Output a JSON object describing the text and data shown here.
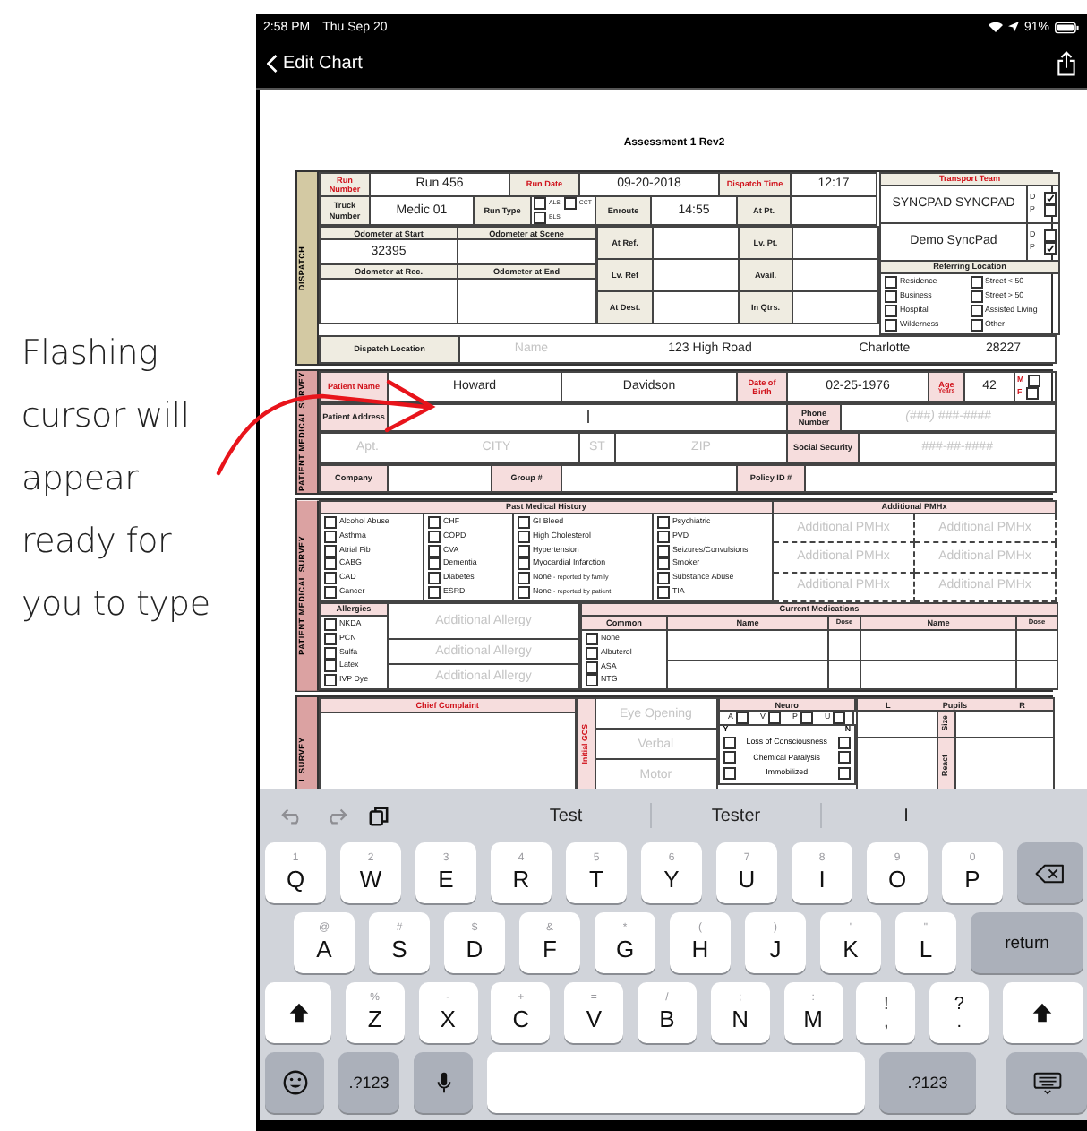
{
  "status_bar": {
    "time": "2:58 PM",
    "date": "Thu Sep 20",
    "battery": "91%"
  },
  "nav": {
    "back_label": "Edit Chart"
  },
  "annotation": {
    "text": "Flashing cursor will appear ready for you to type"
  },
  "form": {
    "title": "Assessment 1 Rev2",
    "dispatch": {
      "side_label": "DISPATCH",
      "run_number": {
        "label": "Run Number",
        "value": "Run 456"
      },
      "run_date": {
        "label": "Run Date",
        "value": "09-20-2018"
      },
      "dispatch_time": {
        "label": "Dispatch Time",
        "value": "12:17"
      },
      "truck_number": {
        "label": "Truck Number",
        "value": "Medic 01"
      },
      "run_type": {
        "label": "Run Type",
        "options": [
          {
            "label": "ALS",
            "checked": false
          },
          {
            "label": "CCT",
            "checked": false
          },
          {
            "label": "BLS",
            "checked": false
          }
        ]
      },
      "times": [
        {
          "label": "Enroute",
          "value": "14:55"
        },
        {
          "label": "At Pt."
        },
        {
          "label": "At Ref."
        },
        {
          "label": "Lv. Pt."
        },
        {
          "label": "Lv. Ref"
        },
        {
          "label": "Avail."
        },
        {
          "label": "At Dest."
        },
        {
          "label": "In Qtrs."
        }
      ],
      "odometers": [
        {
          "label": "Odometer at Start",
          "value": "32395"
        },
        {
          "label": "Odometer at Scene"
        },
        {
          "label": "Odometer at Rec."
        },
        {
          "label": "Odometer at End"
        }
      ],
      "transport_team": {
        "title": "Transport Team",
        "members": [
          {
            "name": "SYNCPAD SYNCPAD",
            "options": [
              {
                "label": "D",
                "checked": true
              },
              {
                "label": "P",
                "checked": false
              }
            ]
          },
          {
            "name": "Demo SyncPad",
            "options": [
              {
                "label": "D",
                "checked": false
              },
              {
                "label": "P",
                "checked": true
              }
            ]
          }
        ]
      },
      "referring_location": {
        "title": "Referring Location",
        "options": [
          {
            "label": "Residence",
            "checked": false
          },
          {
            "label": "Street < 50",
            "checked": false
          },
          {
            "label": "Business",
            "checked": false
          },
          {
            "label": "Street > 50",
            "checked": false
          },
          {
            "label": "Hospital",
            "checked": false
          },
          {
            "label": "Assisted Living",
            "checked": false
          },
          {
            "label": "Wilderness",
            "checked": false
          },
          {
            "label": "Other",
            "checked": false
          }
        ]
      },
      "dispatch_location": {
        "label": "Dispatch Location",
        "name_placeholder": "Name",
        "address": "123 High Road",
        "city": "Charlotte",
        "zip": "28227"
      }
    },
    "patient": {
      "side_labels": [
        "PATIENT MEDICAL SURVEY",
        "PATIENT MEDICAL SURVEY",
        "L SURVEY"
      ],
      "name": {
        "label": "Patient Name",
        "first": "Howard",
        "last": "Davidson"
      },
      "dob": {
        "label": "Date of Birth",
        "value": "02-25-1976"
      },
      "age": {
        "label": "Age",
        "unit": "Years",
        "value": "42"
      },
      "sex": [
        {
          "label": "M",
          "checked": false
        },
        {
          "label": "F",
          "checked": false
        }
      ],
      "address": {
        "label": "Patient Address",
        "focused": true
      },
      "phone": {
        "label": "Phone Number",
        "placeholder": "(###) ###-####"
      },
      "apt": {
        "placeholder": "Apt."
      },
      "city": {
        "placeholder": "CITY"
      },
      "state": {
        "placeholder": "ST"
      },
      "zip": {
        "placeholder": "ZIP"
      },
      "ssn": {
        "label": "Social Security",
        "placeholder": "###-##-####"
      },
      "company": {
        "label": "Company"
      },
      "group": {
        "label": "Group #"
      },
      "policy": {
        "label": "Policy ID #"
      },
      "history": {
        "title": "Past Medical History",
        "columns": [
          [
            {
              "label": "Alcohol Abuse",
              "checked": false
            },
            {
              "label": "Asthma",
              "checked": false
            },
            {
              "label": "Atrial Fib",
              "checked": false
            },
            {
              "label": "CABG",
              "checked": false
            },
            {
              "label": "CAD",
              "checked": false
            },
            {
              "label": "Cancer",
              "checked": false
            }
          ],
          [
            {
              "label": "CHF",
              "checked": false
            },
            {
              "label": "COPD",
              "checked": false
            },
            {
              "label": "CVA",
              "checked": false
            },
            {
              "label": "Dementia",
              "checked": false
            },
            {
              "label": "Diabetes",
              "checked": false
            },
            {
              "label": "ESRD",
              "checked": false
            }
          ],
          [
            {
              "label": "GI Bleed",
              "checked": false
            },
            {
              "label": "High Cholesterol",
              "checked": false
            },
            {
              "label": "Hypertension",
              "checked": false
            },
            {
              "label": "Myocardial Infarction",
              "checked": false
            },
            {
              "label": "None",
              "note": "- reported by family",
              "checked": false
            },
            {
              "label": "None",
              "note": "- reported by patient",
              "checked": false
            }
          ],
          [
            {
              "label": "Psychiatric",
              "checked": false
            },
            {
              "label": "PVD",
              "checked": false
            },
            {
              "label": "Seizures/Convulsions",
              "checked": false
            },
            {
              "label": "Smoker",
              "checked": false
            },
            {
              "label": "Substance Abuse",
              "checked": false
            },
            {
              "label": "TIA",
              "checked": false
            }
          ]
        ]
      },
      "additional_pmhx": {
        "title": "Additional PMHx",
        "fields": [
          {
            "placeholder": "Additional PMHx"
          },
          {
            "placeholder": "Additional PMHx"
          },
          {
            "placeholder": "Additional PMHx"
          },
          {
            "placeholder": "Additional PMHx"
          },
          {
            "placeholder": "Additional PMHx"
          },
          {
            "placeholder": "Additional PMHx"
          }
        ]
      },
      "allergies": {
        "title": "Allergies",
        "options": [
          {
            "label": "NKDA",
            "checked": false
          },
          {
            "label": "PCN",
            "checked": false
          },
          {
            "label": "Sulfa",
            "checked": false
          },
          {
            "label": "Latex",
            "checked": false
          },
          {
            "label": "IVP Dye",
            "checked": false
          }
        ],
        "fields": [
          {
            "placeholder": "Additional Allergy"
          },
          {
            "placeholder": "Additional Allergy"
          },
          {
            "placeholder": "Additional Allergy"
          }
        ]
      },
      "medications": {
        "title": "Current Medications",
        "common_title": "Common",
        "columns": [
          "Name",
          "Dose",
          "Name",
          "Dose"
        ],
        "common": [
          {
            "label": "None",
            "checked": false
          },
          {
            "label": "Albuterol",
            "checked": false
          },
          {
            "label": "ASA",
            "checked": false
          },
          {
            "label": "NTG",
            "checked": false
          }
        ]
      },
      "chief_complaint": {
        "title": "Chief Complaint"
      },
      "gcs": {
        "title": "Initial GCS",
        "fields": [
          {
            "placeholder": "Eye Opening"
          },
          {
            "placeholder": "Verbal"
          },
          {
            "placeholder": "Motor"
          }
        ]
      },
      "neuro": {
        "title": "Neuro",
        "avpu": [
          {
            "label": "A",
            "checked": false
          },
          {
            "label": "V",
            "checked": false
          },
          {
            "label": "P",
            "checked": false
          },
          {
            "label": "U",
            "checked": false
          }
        ],
        "yes": "Y",
        "no": "N",
        "items": [
          {
            "label": "Loss of Consciousness",
            "yes": false,
            "no": false
          },
          {
            "label": "Chemical Paralysis",
            "yes": false,
            "no": false
          },
          {
            "label": "Immobilized",
            "yes": false,
            "no": false
          }
        ]
      },
      "pupils": {
        "left": "L",
        "title": "Pupils",
        "right": "R",
        "rows": [
          "Size",
          "React"
        ]
      }
    }
  },
  "keyboard": {
    "suggestions": [
      "Test",
      "Tester",
      "I"
    ],
    "rows": [
      [
        {
          "kind": "char",
          "label": "Q",
          "alt": "1"
        },
        {
          "kind": "char",
          "label": "W",
          "alt": "2"
        },
        {
          "kind": "char",
          "label": "E",
          "alt": "3"
        },
        {
          "kind": "char",
          "label": "R",
          "alt": "4"
        },
        {
          "kind": "char",
          "label": "T",
          "alt": "5"
        },
        {
          "kind": "char",
          "label": "Y",
          "alt": "6"
        },
        {
          "kind": "char",
          "label": "U",
          "alt": "7"
        },
        {
          "kind": "char",
          "label": "I",
          "alt": "8"
        },
        {
          "kind": "char",
          "label": "O",
          "alt": "9"
        },
        {
          "kind": "char",
          "label": "P",
          "alt": "0"
        },
        {
          "kind": "backspace"
        }
      ],
      [
        {
          "kind": "char",
          "label": "A",
          "alt": "@"
        },
        {
          "kind": "char",
          "label": "S",
          "alt": "#"
        },
        {
          "kind": "char",
          "label": "D",
          "alt": "$"
        },
        {
          "kind": "char",
          "label": "F",
          "alt": "&"
        },
        {
          "kind": "char",
          "label": "G",
          "alt": "*"
        },
        {
          "kind": "char",
          "label": "H",
          "alt": "("
        },
        {
          "kind": "char",
          "label": "J",
          "alt": ")"
        },
        {
          "kind": "char",
          "label": "K",
          "alt": "'"
        },
        {
          "kind": "char",
          "label": "L",
          "alt": "\""
        },
        {
          "kind": "return",
          "label": "return"
        }
      ],
      [
        {
          "kind": "shift"
        },
        {
          "kind": "char",
          "label": "Z",
          "alt": "%"
        },
        {
          "kind": "char",
          "label": "X",
          "alt": "-"
        },
        {
          "kind": "char",
          "label": "C",
          "alt": "+"
        },
        {
          "kind": "char",
          "label": "V",
          "alt": "="
        },
        {
          "kind": "char",
          "label": "B",
          "alt": "/"
        },
        {
          "kind": "char",
          "label": "N",
          "alt": ";"
        },
        {
          "kind": "char",
          "label": "M",
          "alt": ":"
        },
        {
          "kind": "punct",
          "label": "!",
          "alt": ","
        },
        {
          "kind": "punct",
          "label": "?",
          "alt": "."
        },
        {
          "kind": "shift"
        }
      ],
      [
        {
          "kind": "emoji"
        },
        {
          "kind": "mode",
          "label": ".?123"
        },
        {
          "kind": "mic"
        },
        {
          "kind": "space"
        },
        {
          "kind": "mode",
          "label": ".?123"
        },
        {
          "kind": "hide"
        }
      ]
    ]
  }
}
